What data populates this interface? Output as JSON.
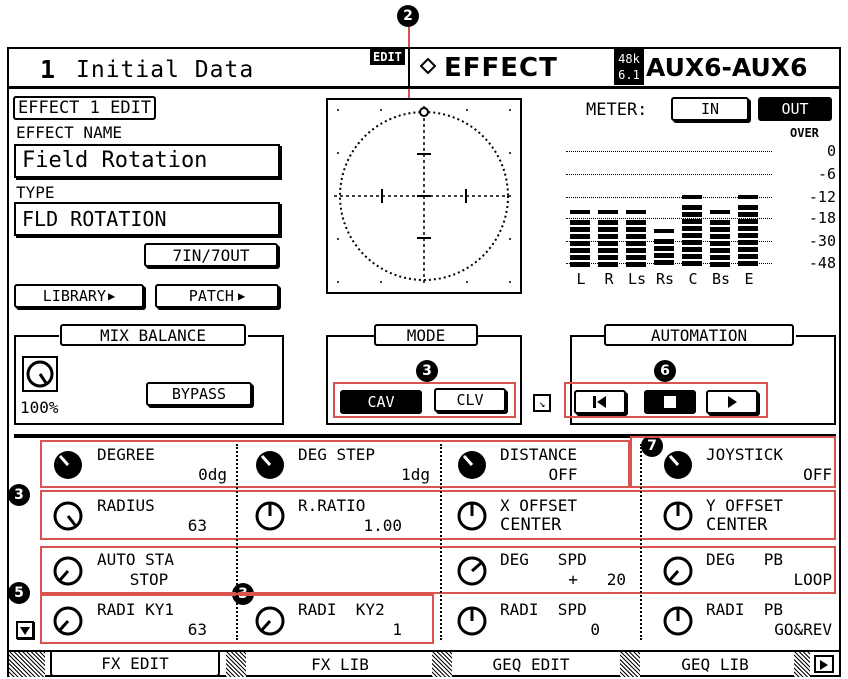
{
  "header": {
    "scene_number": "1",
    "scene_name": "Initial Data",
    "edit_flag": "EDIT",
    "page_title": "EFFECT",
    "rate_top": "48k",
    "rate_bottom": "6.1",
    "bus": "AUX6-AUX6"
  },
  "callouts": [
    "2",
    "3",
    "3",
    "6",
    "7",
    "3",
    "5",
    "3"
  ],
  "left_panel": {
    "section_title": "EFFECT 1 EDIT",
    "effect_name_label": "EFFECT NAME",
    "effect_name": "Field Rotation",
    "type_label": "TYPE",
    "type_value": "FLD ROTATION",
    "io": "7IN/7OUT",
    "library_button": "LIBRARY",
    "patch_button": "PATCH"
  },
  "meter": {
    "label": "METER:",
    "in_button": "IN",
    "out_button": "OUT",
    "over_label": "OVER",
    "scale": [
      "0",
      "6",
      "12",
      "18",
      "30",
      "48"
    ],
    "channels": [
      "L",
      "R",
      "Ls",
      "Rs",
      "C",
      "Bs",
      "E"
    ],
    "levels_db": [
      -18,
      -18,
      -18,
      -30,
      -12,
      -18,
      -12
    ]
  },
  "mix_balance": {
    "title": "MIX BALANCE",
    "value": "100%",
    "bypass_button": "BYPASS"
  },
  "mode": {
    "title": "MODE",
    "cav": "CAV",
    "clv": "CLV"
  },
  "automation": {
    "title": "AUTOMATION"
  },
  "params": {
    "degree": {
      "label": "DEGREE",
      "value": "0dg"
    },
    "deg_step": {
      "label": "DEG STEP",
      "value": "1dg"
    },
    "distance": {
      "label": "DISTANCE",
      "value": "OFF"
    },
    "joystick": {
      "label": "JOYSTICK",
      "value": "OFF"
    },
    "radius": {
      "label": "RADIUS",
      "value": "63"
    },
    "r_ratio": {
      "label": "R.RATIO",
      "value": "1.00"
    },
    "x_offset": {
      "label": "X OFFSET",
      "value": "CENTER"
    },
    "y_offset": {
      "label": "Y OFFSET",
      "value": "CENTER"
    },
    "auto_sta": {
      "label": "AUTO STA",
      "value": "STOP"
    },
    "deg_spd": {
      "label": "DEG   SPD",
      "value": "+   20"
    },
    "deg_pb": {
      "label": "DEG   PB",
      "value": "LOOP"
    },
    "radi_ky1": {
      "label": "RADI KY1",
      "value": "63"
    },
    "radi_ky2": {
      "label": "RADI  KY2",
      "value": "1"
    },
    "radi_spd": {
      "label": "RADI  SPD",
      "value": "0"
    },
    "radi_pb": {
      "label": "RADI  PB",
      "value": "GO&REV"
    }
  },
  "tabs": [
    "FX EDIT",
    "FX LIB",
    "GEQ EDIT",
    "GEQ LIB"
  ]
}
